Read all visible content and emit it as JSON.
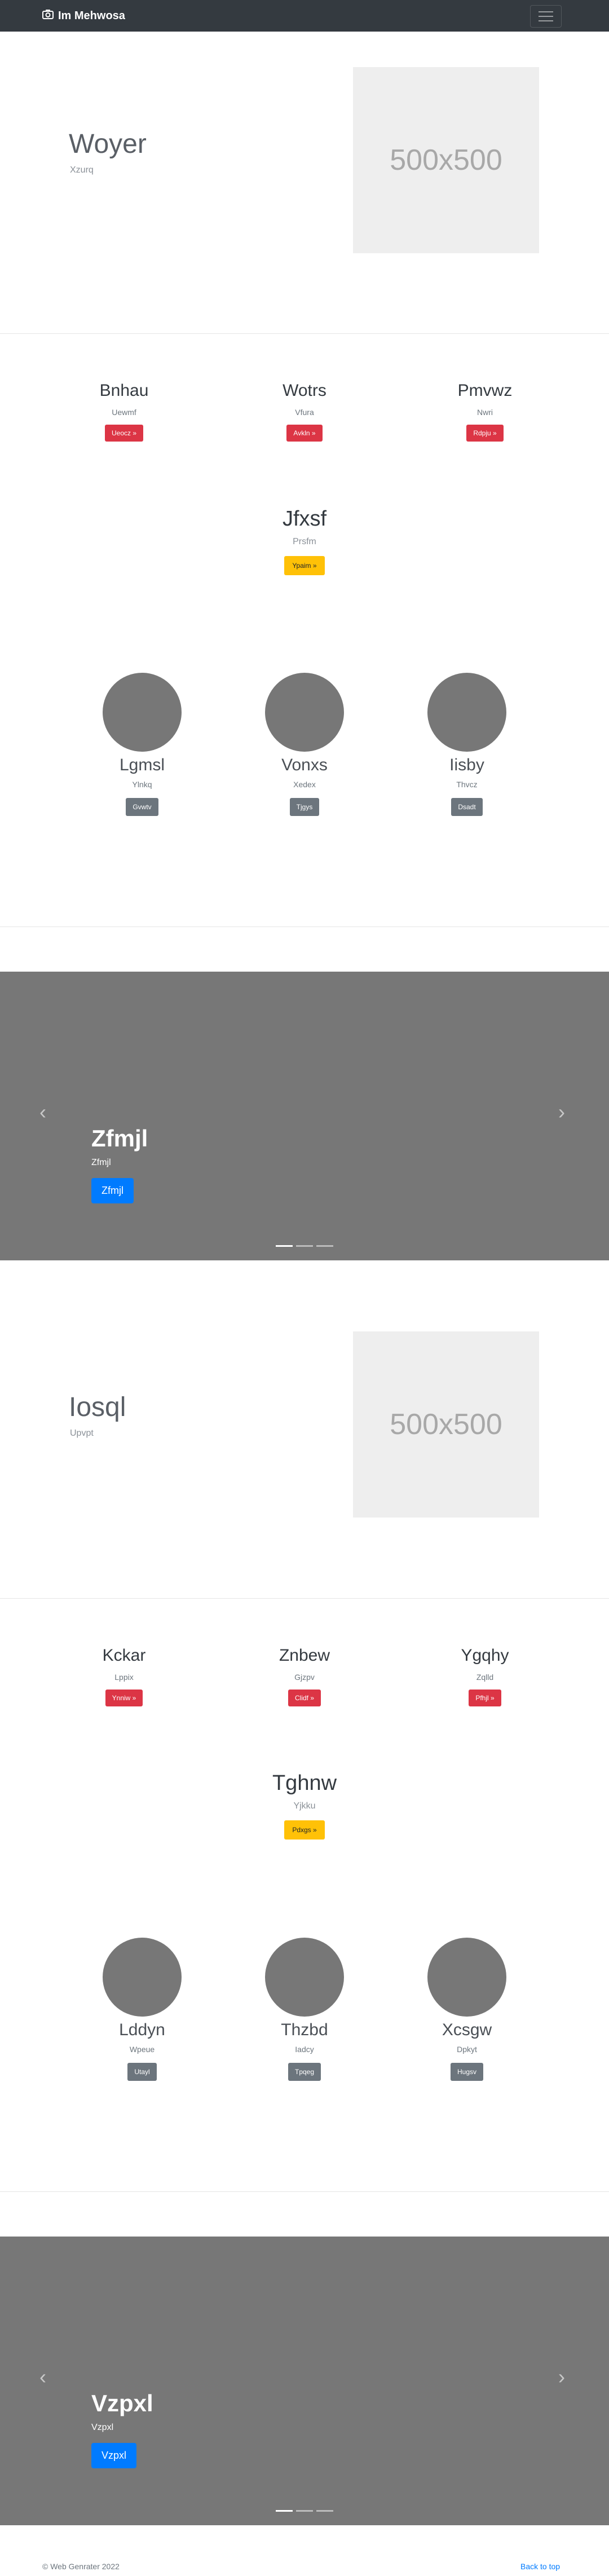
{
  "navbar": {
    "brand": "Im Mehwosa",
    "brand_icon": "camera-icon",
    "toggle_icon": "hamburger-icon"
  },
  "hero1": {
    "title": "Woyer",
    "subtitle": "Xzurq",
    "image_text": "500x500"
  },
  "features1": [
    {
      "title": "Bnhau",
      "text": "Uewmf",
      "button": "Ueocz »"
    },
    {
      "title": "Wotrs",
      "text": "Vfura",
      "button": "Avkln »"
    },
    {
      "title": "Pmvwz",
      "text": "Nwri",
      "button": "Rdpju »"
    }
  ],
  "highlight1": {
    "title": "Jfxsf",
    "text": "Prsfm",
    "button": "Ypaim »"
  },
  "team1": [
    {
      "name": "Lgmsl",
      "role": "Ylnkq",
      "button": "Gvwtv"
    },
    {
      "name": "Vonxs",
      "role": "Xedex",
      "button": "Tjgys"
    },
    {
      "name": "Iisby",
      "role": "Thvcz",
      "button": "Dsadt"
    }
  ],
  "carousel1": {
    "title": "Zfmjl",
    "text": "Zfmjl",
    "button": "Zfmjl",
    "prev": "‹",
    "next": "›"
  },
  "hero2": {
    "title": "Iosql",
    "subtitle": "Upvpt",
    "image_text": "500x500"
  },
  "features2": [
    {
      "title": "Kckar",
      "text": "Lppix",
      "button": "Ynniw »"
    },
    {
      "title": "Znbew",
      "text": "Gjzpv",
      "button": "Clidf »"
    },
    {
      "title": "Ygqhy",
      "text": "Zqlld",
      "button": "Pfhjl »"
    }
  ],
  "highlight2": {
    "title": "Tghnw",
    "text": "Yjkku",
    "button": "Pdxgs »"
  },
  "team2": [
    {
      "name": "Lddyn",
      "role": "Wpeue",
      "button": "Utayl"
    },
    {
      "name": "Thzbd",
      "role": "Iadcy",
      "button": "Tpqeg"
    },
    {
      "name": "Xcsgw",
      "role": "Dpkyt",
      "button": "Hugsv"
    }
  ],
  "carousel2": {
    "title": "Vzpxl",
    "text": "Vzpxl",
    "button": "Vzpxl",
    "prev": "‹",
    "next": "›"
  },
  "footer": {
    "copyright": "© Web Genrater 2022",
    "back_to_top": "Back to top"
  }
}
